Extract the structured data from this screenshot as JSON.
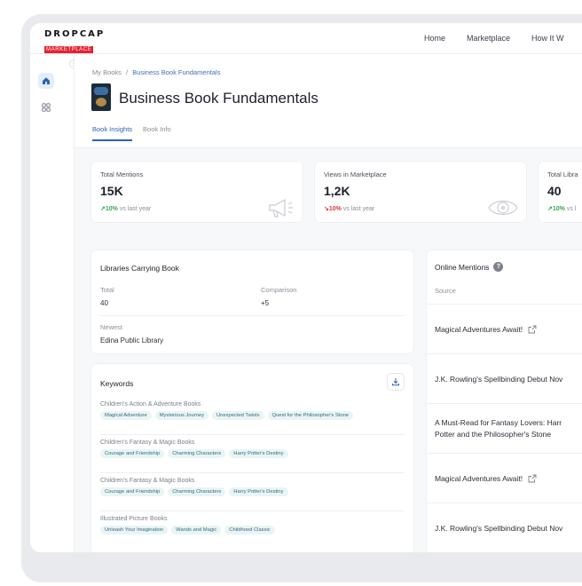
{
  "app": {
    "logo_line1": "DROPCAP",
    "logo_line2": "MARKETPLACE",
    "nav": [
      "Home",
      "Marketplace",
      "How It W"
    ]
  },
  "breadcrumb": {
    "parent": "My Books",
    "separator": "/",
    "current": "Business Book Fundamentals"
  },
  "book": {
    "title": "Business Book Fundamentals"
  },
  "tabs": [
    "Book Insights",
    "Book Info"
  ],
  "stats": [
    {
      "label": "Total Mentions",
      "value": "15K",
      "trend": "↗10%",
      "trend_dir": "up",
      "suffix": "vs last year",
      "icon": "megaphone-icon"
    },
    {
      "label": "Views in Marketplace",
      "value": "1,2K",
      "trend": "↘10%",
      "trend_dir": "down",
      "suffix": "vs last year",
      "icon": "eye-icon"
    },
    {
      "label": "Total Libra",
      "value": "40",
      "trend": "↗10%",
      "trend_dir": "up",
      "suffix": "vs l",
      "icon": ""
    }
  ],
  "libraries": {
    "title": "Libraries Carrying Book",
    "total_label": "Total",
    "total_value": "40",
    "comparison_label": "Comparison",
    "comparison_value": "+5",
    "newest_label": "Newest",
    "newest_value": "Edina Public Library"
  },
  "keywords": {
    "title": "Keywords",
    "groups": [
      {
        "category": "Children's Action & Adventure Books",
        "chips": [
          "Magical Adventure",
          "Mysterious Journey",
          "Unexpected Twists",
          "Quest for the Philosopher's Stone"
        ]
      },
      {
        "category": "Children's Fantasy & Magic Books",
        "chips": [
          "Courage and Friendship",
          "Charming Characters",
          "Harry Potter's Destiny"
        ]
      },
      {
        "category": "Children's Fantasy & Magic Books",
        "chips": [
          "Courage and Friendship",
          "Charming Characters",
          "Harry Potter's Destiny"
        ]
      },
      {
        "category": "Illustrated Picture Books",
        "chips": [
          "Unleash Your Imagination",
          "Wands and Magic",
          "Childhood Classic"
        ]
      }
    ]
  },
  "mentions": {
    "title": "Online Mentions",
    "help": "?",
    "column": "Source",
    "rows": [
      {
        "line1": "Magical Adventures Await!",
        "line2": "",
        "link": true
      },
      {
        "line1": "J.K. Rowling's Spellbinding Debut Nov",
        "line2": "",
        "link": false
      },
      {
        "line1": "A Must-Read for Fantasy Lovers: Harr",
        "line2": "Potter and the Philosopher's Stone",
        "link": false
      },
      {
        "line1": "Magical Adventures Await!",
        "line2": "",
        "link": true
      },
      {
        "line1": "J.K. Rowling's Spellbinding Debut Nov",
        "line2": "",
        "link": false
      }
    ]
  },
  "colors": {
    "accent": "#2c63b5",
    "brand_red": "#e8212f",
    "trend_up": "#2fa84f",
    "trend_down": "#e2353f",
    "chip_bg": "#e9f4f5"
  }
}
